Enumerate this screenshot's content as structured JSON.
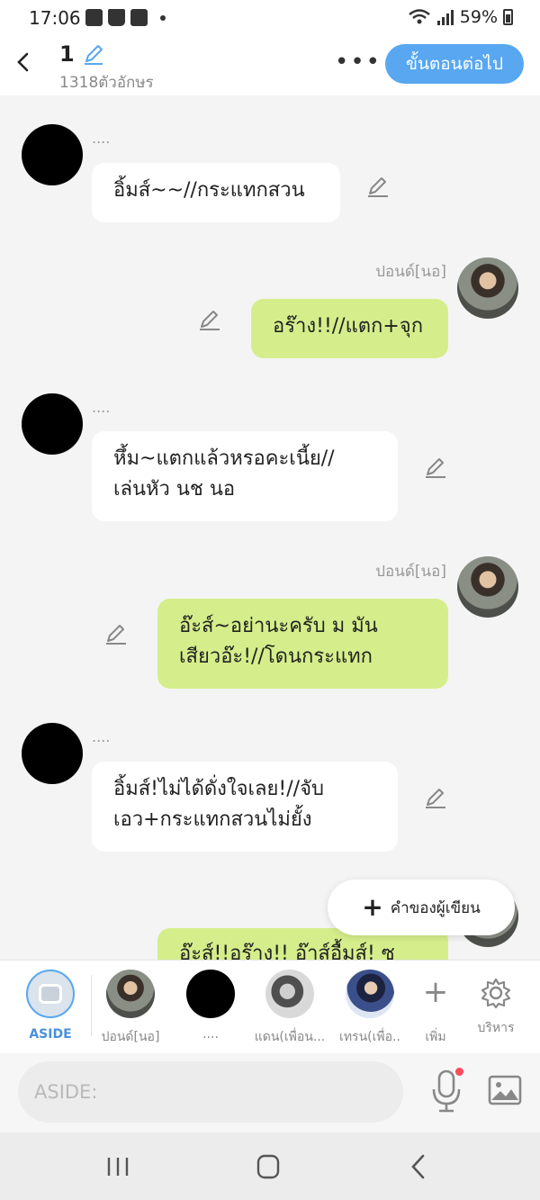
{
  "status_bar": {
    "time": "17:06",
    "battery": "59%",
    "icons": [
      "gallery-icon",
      "bag-icon",
      "facebook-icon",
      "dot-icon",
      "wifi-icon",
      "signal-icon",
      "battery-icon"
    ]
  },
  "header": {
    "title": "1",
    "char_count": "1318ตัวอักษร",
    "next_button": "ขั้นตอนต่อไป",
    "more": "•••"
  },
  "messages": [
    {
      "side": "left",
      "sender": "....",
      "text": "อิ้มส์~~//กระแทกสวน"
    },
    {
      "side": "right",
      "sender": "ปอนด์[นอ]",
      "text": "อร๊าง!!//แตก+จุก"
    },
    {
      "side": "left",
      "sender": "....",
      "line1": "หึ้ม~แตกแล้วหรอคะเนี้ย//",
      "line2": "เล่นหัว นช นอ"
    },
    {
      "side": "right",
      "sender": "ปอนด์[นอ]",
      "line1": "อ๊ะส์~อย่านะครับ ม มัน",
      "line2": "เสียวอ๊ะ!//โดนกระแทก"
    },
    {
      "side": "left",
      "sender": "....",
      "line1": "อิ้มส์!ไม่ได้ดั่งใจเลย!//จับ",
      "line2": "เอว+กระแทกสวนไม่ยั้ง"
    },
    {
      "side": "right",
      "sender": "",
      "text": "อ๊ะส์!!อร๊าง!! อ๊าส์อื้มส์! ซ"
    }
  ],
  "writer_button": "คำของผู้เขียน",
  "character_bar": [
    {
      "label": "ASIDE"
    },
    {
      "label": "ปอนด์[นอ]"
    },
    {
      "label": "...."
    },
    {
      "label": "แดน(เพื่อน..."
    },
    {
      "label": "เทรน(เพื่อ.."
    },
    {
      "label": "เพิ่ม"
    },
    {
      "label": "บริหาร"
    }
  ],
  "input": {
    "placeholder": "ASIDE:"
  },
  "colors": {
    "accent": "#58a7f0",
    "green_bubble": "#d5ee8b",
    "background": "#f4f4f4"
  }
}
